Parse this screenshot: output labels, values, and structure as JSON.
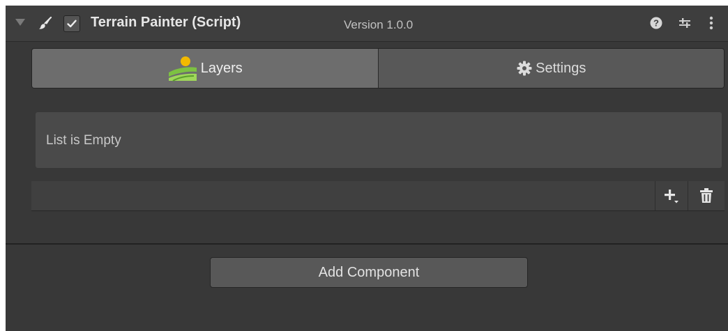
{
  "component": {
    "title": "Terrain Painter (Script)",
    "version": "Version 1.0.0",
    "enabled": true
  },
  "header_icons": [
    "foldout-arrow-icon",
    "brush-icon",
    "help-icon",
    "presets-icon",
    "kebab-menu-icon"
  ],
  "tabs": [
    {
      "label": "Layers",
      "icon": "terrain-layers-icon",
      "active": true
    },
    {
      "label": "Settings",
      "icon": "gear-icon",
      "active": false
    }
  ],
  "list": {
    "empty_text": "List is Empty",
    "add_icon": "plus-dropdown-icon",
    "remove_icon": "trash-icon"
  },
  "add_component": {
    "label": "Add Component"
  },
  "colors": {
    "panel_bg": "#383838",
    "accent_green": "#7dc142",
    "accent_yellow": "#f2b900"
  }
}
